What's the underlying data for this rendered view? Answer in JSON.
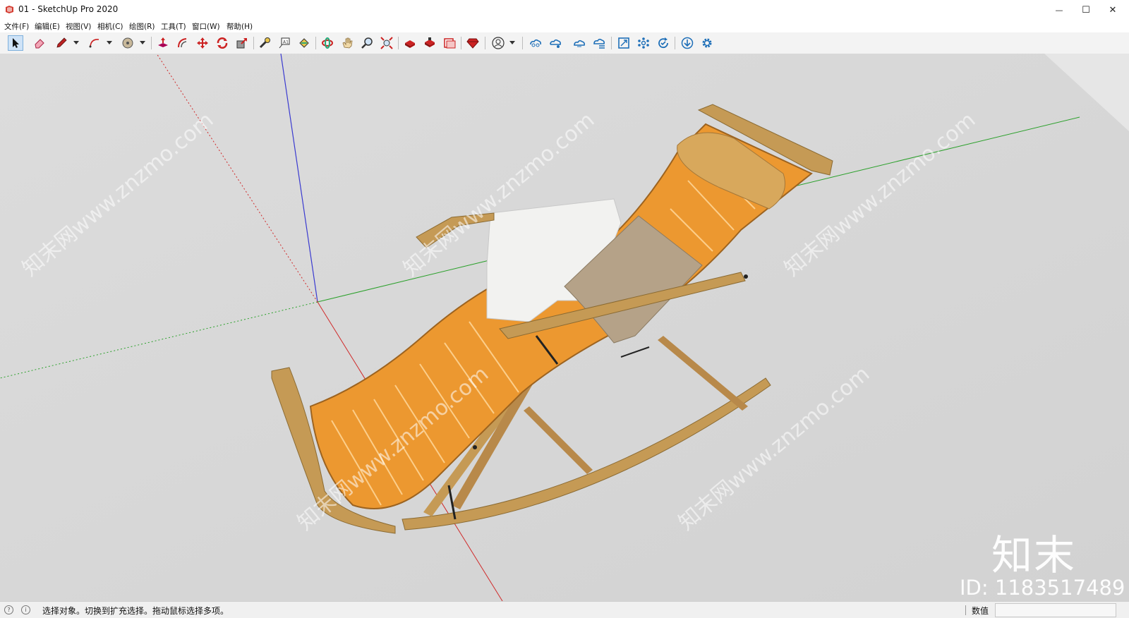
{
  "window": {
    "title": "01 - SketchUp Pro 2020",
    "minimize_glyph": "—",
    "maximize_glyph": "☐",
    "close_glyph": "✕"
  },
  "menu": [
    "文件(F)",
    "编辑(E)",
    "视图(V)",
    "相机(C)",
    "绘图(R)",
    "工具(T)",
    "窗口(W)",
    "帮助(H)"
  ],
  "toolbar": {
    "tools": [
      {
        "name": "select-tool",
        "icon": "arrow-cursor-icon",
        "active": true
      },
      {
        "name": "eraser-tool",
        "icon": "eraser-icon"
      },
      {
        "name": "pencil-line-tool",
        "icon": "pencil-icon",
        "dropdown": true
      },
      {
        "name": "arc-tool",
        "icon": "arc-icon",
        "dropdown": true
      },
      {
        "name": "shapes-tool",
        "icon": "circle-shape-icon",
        "dropdown": true
      },
      {
        "name": "push-pull-tool",
        "icon": "push-pull-icon"
      },
      {
        "name": "offset-tool",
        "icon": "offset-icon"
      },
      {
        "name": "move-tool",
        "icon": "move-icon"
      },
      {
        "name": "rotate-tool",
        "icon": "rotate-icon"
      },
      {
        "name": "scale-tool",
        "icon": "scale-icon"
      },
      {
        "name": "tape-measure-tool",
        "icon": "tape-measure-icon"
      },
      {
        "name": "text-tool",
        "icon": "text-icon"
      },
      {
        "name": "paint-bucket-tool",
        "icon": "paint-bucket-icon"
      },
      {
        "name": "orbit-tool",
        "icon": "orbit-icon"
      },
      {
        "name": "pan-tool",
        "icon": "hand-icon"
      },
      {
        "name": "zoom-tool",
        "icon": "magnifier-icon"
      },
      {
        "name": "zoom-extents-tool",
        "icon": "zoom-extents-icon"
      },
      {
        "name": "3d-warehouse",
        "icon": "warehouse-icon"
      },
      {
        "name": "extension-warehouse",
        "icon": "extension-warehouse-icon"
      },
      {
        "name": "send-to-layout",
        "icon": "layout-icon"
      },
      {
        "name": "extension-manager",
        "icon": "ruby-gem-icon"
      },
      {
        "name": "account",
        "icon": "user-icon",
        "dropdown": true
      },
      {
        "name": "trimble-connect-1",
        "icon": "cloud-link-icon"
      },
      {
        "name": "trimble-connect-2",
        "icon": "cloud-share-icon"
      },
      {
        "name": "trimble-connect-3",
        "icon": "cloud-sync-icon"
      },
      {
        "name": "trimble-connect-4",
        "icon": "cloud-list-icon"
      },
      {
        "name": "view-fit",
        "icon": "frame-icon"
      },
      {
        "name": "components-view",
        "icon": "nodes-icon"
      },
      {
        "name": "refresh-view",
        "icon": "refresh-check-icon"
      },
      {
        "name": "download",
        "icon": "download-icon"
      },
      {
        "name": "settings",
        "icon": "gear-icon"
      }
    ]
  },
  "watermark": {
    "logo": "知末",
    "id_text": "ID: 1183517489",
    "diagonal": "知末网www.znzmo.com"
  },
  "status": {
    "text": "选择对象。切换到扩充选择。拖动鼠标选择多项。",
    "measurements_label": "数值",
    "measurements_value": ""
  }
}
